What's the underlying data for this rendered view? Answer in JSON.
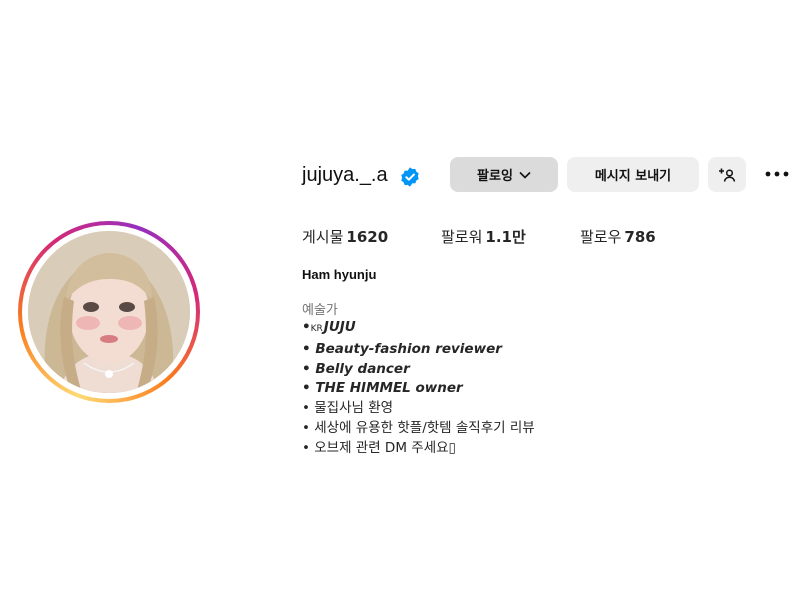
{
  "profile": {
    "username": "jujuya._.a",
    "display_name": "Ham hyunju",
    "category": "예술가",
    "verified": true
  },
  "actions": {
    "following_label": "팔로잉",
    "message_label": "메시지 보내기",
    "add_user_icon": "person-add-icon",
    "more_icon": "more-options-icon"
  },
  "stats": {
    "posts_label": "게시물",
    "posts_count": "1620",
    "followers_label": "팔로워",
    "followers_count": "1.1만",
    "following_label": "팔로우",
    "following_count": "786"
  },
  "bio": {
    "line1_prefix": "•",
    "line1_flag": "KR",
    "line1_text": "JUJU",
    "line2": "• Beauty-fashion reviewer",
    "line3": "• Belly dancer",
    "line4": "• THE HIMMEL owner",
    "line5": "• 물집사님 환영",
    "line6": "• 세상에 유용한 핫플/핫템 솔직후기 리뷰",
    "line7": "• 오브제 관련 DM 주세요▯"
  },
  "colors": {
    "verified_blue": "#0095f6",
    "button_bg": "#efefef",
    "following_bg": "#dbdbdb",
    "muted_text": "#737373"
  }
}
